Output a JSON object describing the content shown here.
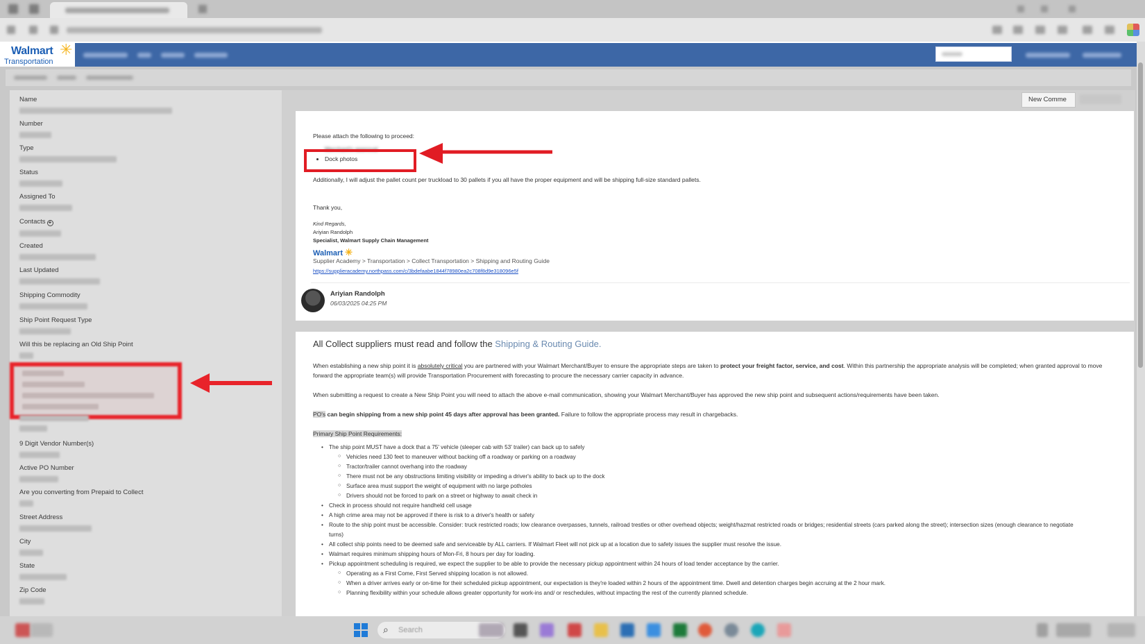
{
  "app": {
    "logo_brand": "Walmart",
    "logo_sub": "Transportation"
  },
  "left_panel": {
    "fields": [
      {
        "label": "Name"
      },
      {
        "label": "Number"
      },
      {
        "label": "Type"
      },
      {
        "label": "Status"
      },
      {
        "label": "Assigned To"
      },
      {
        "label": "Contacts"
      },
      {
        "label": "Created"
      },
      {
        "label": "Last Updated"
      },
      {
        "label": "Shipping Commodity"
      },
      {
        "label": "Ship Point Request Type"
      },
      {
        "label": "Will this be replacing an Old Ship Point"
      },
      {
        "label": "9 Digit Vendor Number(s)"
      },
      {
        "label": "Active PO Number"
      },
      {
        "label": "Are you converting from Prepaid to Collect"
      },
      {
        "label": "Street Address"
      },
      {
        "label": "City"
      },
      {
        "label": "State"
      },
      {
        "label": "Zip Code"
      }
    ]
  },
  "toolbar": {
    "new_comment": "New Comme"
  },
  "comment": {
    "intro": "Please attach the following to proceed:",
    "bullet_1": "Merchant's approval",
    "bullet_2": "Dock photos",
    "additional": "Additionally, I will adjust the pallet count per truckload to 30 pallets if you all have the proper equipment and will be shipping full-size standard pallets.",
    "thanks": "Thank you,",
    "regards": "Kind Regards,",
    "sig_name": "Ariyian Randolph",
    "sig_title": "Specialist, Walmart Supply Chain Management",
    "sig_brand": "Walmart",
    "guide_path": "Supplier Academy > Transportation >  Collect Transportation > Shipping and Routing Guide",
    "guide_url": "https://supplieracademy.northpass.com/c/3bdefaabe1844f78980ea2c708f8d9e318096e5f",
    "author": "Ariyian Randolph",
    "datetime": "06/03/2025 04:25 PM"
  },
  "info": {
    "heading_prefix": "All Collect suppliers must read and follow the ",
    "heading_link": "Shipping & Routing Guide.",
    "p1a": "When establishing a new ship point it is ",
    "p1b": "absolutely critical",
    "p1c": " you are partnered with your Walmart Merchant/Buyer to ensure the appropriate steps are taken to ",
    "p1d": "protect your freight factor, service, and cost",
    "p1e": ". Within this partnership the appropriate analysis will be completed; when granted approval to move",
    "p1f": "forward the appropriate team(s) will provide Transportation Procurement with forecasting to procure the necessary carrier capacity in advance.",
    "p2": "When submitting a request to create a New Ship Point you will need to attach the above e-mail communication, showing your Walmart Merchant/Buyer has approved the new ship point and subsequent actions/requirements have been taken.",
    "p3a": "PO's",
    "p3b": " can begin shipping from a new ship point 45 days after approval has been granted.",
    "p3c": " Failure to follow the appropriate process may result in chargebacks.",
    "req_heading": "Primary Ship Point Requirements:",
    "items": [
      {
        "level": 1,
        "text": "The ship point MUST have a dock that a 75' vehicle (sleeper cab with 53' trailer) can back up to safely"
      },
      {
        "level": 2,
        "text": "Vehicles need 130 feet to maneuver without backing off a roadway or parking on a roadway"
      },
      {
        "level": 2,
        "text": "Tractor/trailer cannot overhang into the roadway"
      },
      {
        "level": 2,
        "text": "There must not be any obstructions limiting visibility or impeding a driver's ability to back up to the dock"
      },
      {
        "level": 2,
        "text": "Surface area must support the weight of equipment with no large potholes"
      },
      {
        "level": 2,
        "text": "Drivers should not be forced to park on a street or highway to await check in"
      },
      {
        "level": 1,
        "text": "Check in process should not require handheld cell usage"
      },
      {
        "level": 1,
        "text": "A high crime area may not be approved if there is risk to a driver's health or safety"
      },
      {
        "level": 1,
        "text": "Route to the ship point must be accessible.  Consider: truck restricted roads; low clearance overpasses, tunnels, railroad trestles or other overhead objects; weight/hazmat restricted roads or bridges; residential streets (cars parked along the street); intersection sizes (enough clearance to negotiate"
      },
      {
        "level": 0,
        "text": "turns)"
      },
      {
        "level": 1,
        "text": "All collect ship points need to be deemed safe and serviceable by ALL carriers.  If Walmart Fleet will not pick up at a location due to safety issues the supplier must resolve the issue."
      },
      {
        "level": 1,
        "text": "Walmart requires minimum shipping hours of Mon-Fri, 8 hours per day for loading."
      },
      {
        "level": 1,
        "text": "Pickup appointment scheduling is required, we expect the supplier to be able to provide the necessary pickup appointment within 24 hours of load tender acceptance by the carrier."
      },
      {
        "level": 2,
        "text": "Operating as a First Come, First Served shipping location is not allowed."
      },
      {
        "level": 2,
        "text": "When a driver arrives early or on-time for their scheduled pickup appointment, our expectation is they're loaded within 2 hours of the appointment time. Dwell and detention charges begin accruing at the 2 hour mark."
      },
      {
        "level": 2,
        "text": "Planning flexibility within your schedule allows greater opportunity for work-ins and/ or reschedules, without impacting the rest of the currently planned schedule."
      }
    ]
  },
  "taskbar": {
    "search_placeholder": "Search"
  },
  "colors": {
    "walmart_blue": "#1b5eb4",
    "nav_blue": "#3d67a6",
    "spark_yellow": "#f5b31a",
    "highlight_red": "#e8232a",
    "link_blue": "#1a4fc4"
  }
}
